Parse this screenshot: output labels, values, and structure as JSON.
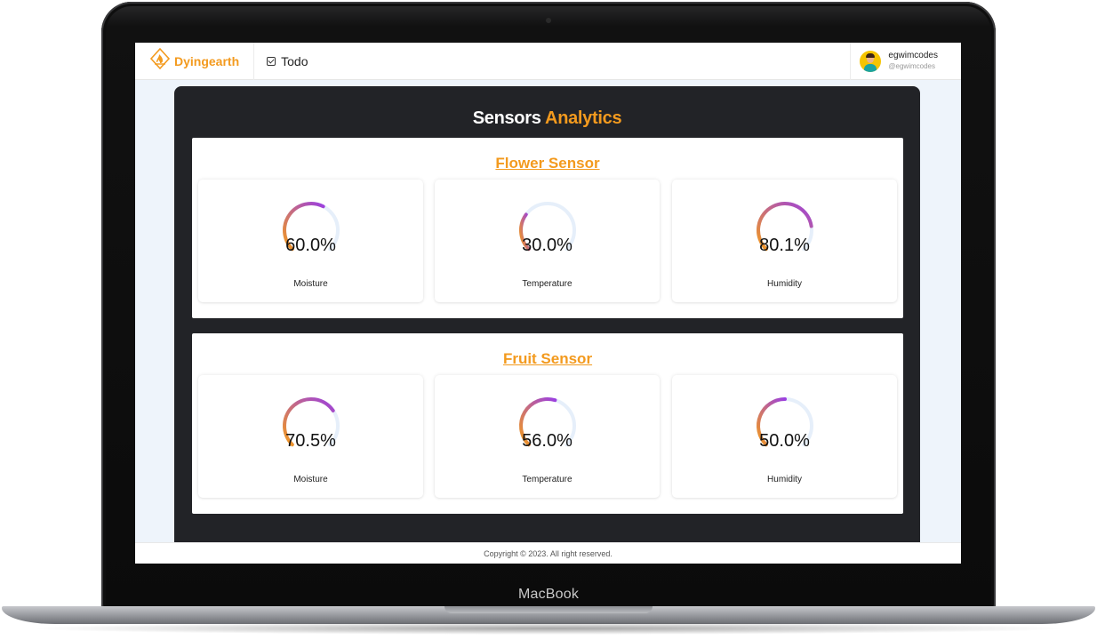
{
  "device": {
    "brand": "MacBook"
  },
  "navbar": {
    "logo_text": "Dyingearth",
    "links": [
      {
        "label": "Todo",
        "icon": "checkbox-icon"
      }
    ],
    "user": {
      "name": "egwimcodes",
      "handle": "@egwimcodes"
    }
  },
  "dashboard": {
    "title_main": "Sensors",
    "title_accent": "Analytics",
    "sensors": [
      {
        "name": "Flower Sensor",
        "metrics": [
          {
            "label": "Moisture",
            "value_text": "60.0%",
            "value": 60.0
          },
          {
            "label": "Temperature",
            "value_text": "30.0%",
            "value": 30.0
          },
          {
            "label": "Humidity",
            "value_text": "80.1%",
            "value": 80.1
          }
        ]
      },
      {
        "name": "Fruit Sensor",
        "metrics": [
          {
            "label": "Moisture",
            "value_text": "70.5%",
            "value": 70.5
          },
          {
            "label": "Temperature",
            "value_text": "56.0%",
            "value": 56.0
          },
          {
            "label": "Humidity",
            "value_text": "50.0%",
            "value": 50.0
          }
        ]
      }
    ]
  },
  "footer": {
    "copyright": "Copyright © 2023. All right reserved."
  },
  "colors": {
    "accent": "#f39a1e",
    "gauge_start": "#f39a1e",
    "gauge_end": "#9b3fe0",
    "gauge_track": "#e6effa",
    "panel_bg": "#222327"
  }
}
